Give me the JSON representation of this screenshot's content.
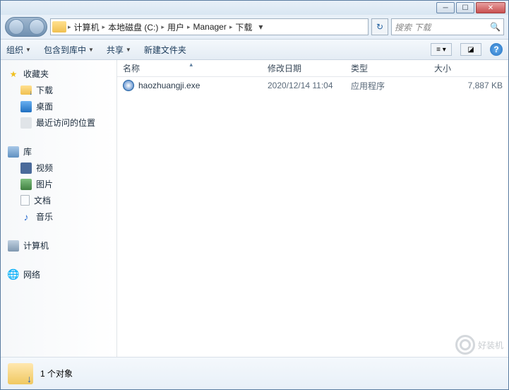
{
  "breadcrumb": [
    "计算机",
    "本地磁盘 (C:)",
    "用户",
    "Manager",
    "下载"
  ],
  "search": {
    "placeholder": "搜索 下载"
  },
  "toolbar": {
    "organize": "组织",
    "include": "包含到库中",
    "share": "共享",
    "newfolder": "新建文件夹"
  },
  "sidebar": {
    "favorites": "收藏夹",
    "downloads": "下载",
    "desktop": "桌面",
    "recent": "最近访问的位置",
    "libraries": "库",
    "videos": "视频",
    "pictures": "图片",
    "documents": "文档",
    "music": "音乐",
    "computer": "计算机",
    "network": "网络"
  },
  "columns": {
    "name": "名称",
    "date": "修改日期",
    "type": "类型",
    "size": "大小"
  },
  "files": [
    {
      "name": "haozhuangji.exe",
      "date": "2020/12/14 11:04",
      "type": "应用程序",
      "size": "7,887 KB"
    }
  ],
  "status": {
    "count": "1 个对象"
  },
  "watermark": "好装机"
}
